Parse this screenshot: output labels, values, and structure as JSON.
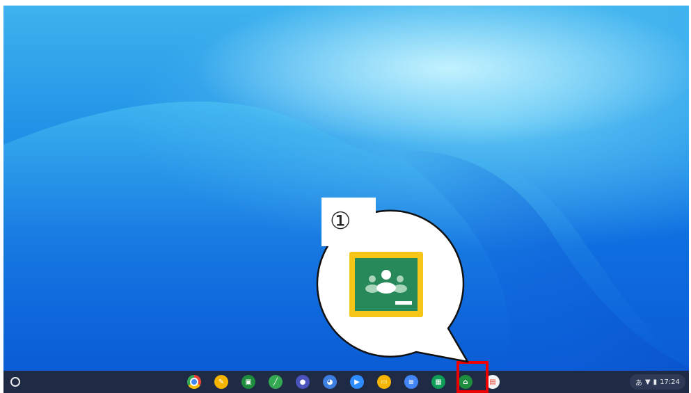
{
  "callout": {
    "step_number": "①"
  },
  "shelf": {
    "launcher_icon": "launcher-circle-icon",
    "apps": [
      {
        "name": "chrome",
        "icon": "chrome-icon",
        "color": "#e8453c"
      },
      {
        "name": "app-b",
        "icon": "pencil-app-icon",
        "color": "#f4b400"
      },
      {
        "name": "app-c",
        "icon": "doc-scanner-icon",
        "color": "#1e8e3e"
      },
      {
        "name": "app-d",
        "icon": "canvas-icon",
        "color": "#34a853"
      },
      {
        "name": "teams",
        "icon": "teams-icon",
        "color": "#4b53bc"
      },
      {
        "name": "scratch",
        "icon": "scratch-cat-icon",
        "color": "#3d7fe0"
      },
      {
        "name": "zoom",
        "icon": "zoom-icon",
        "color": "#2d8cff"
      },
      {
        "name": "slides",
        "icon": "slides-icon",
        "color": "#f4b400"
      },
      {
        "name": "docs",
        "icon": "docs-icon",
        "color": "#4285f4"
      },
      {
        "name": "sheets",
        "icon": "sheets-icon",
        "color": "#0f9d58"
      },
      {
        "name": "classroom",
        "icon": "classroom-icon",
        "color": "#1e8e3e"
      },
      {
        "name": "app-l",
        "icon": "calendar-app-icon",
        "color": "#f1f3f4"
      }
    ]
  },
  "tray": {
    "ime": "あ",
    "wifi_icon": "wifi-icon",
    "battery_icon": "battery-icon",
    "time": "17:24"
  },
  "colors": {
    "shelf_bg": "#1f2a44",
    "highlight": "#ee0000",
    "classroom_frame": "#f5c518",
    "classroom_board": "#27885a"
  }
}
